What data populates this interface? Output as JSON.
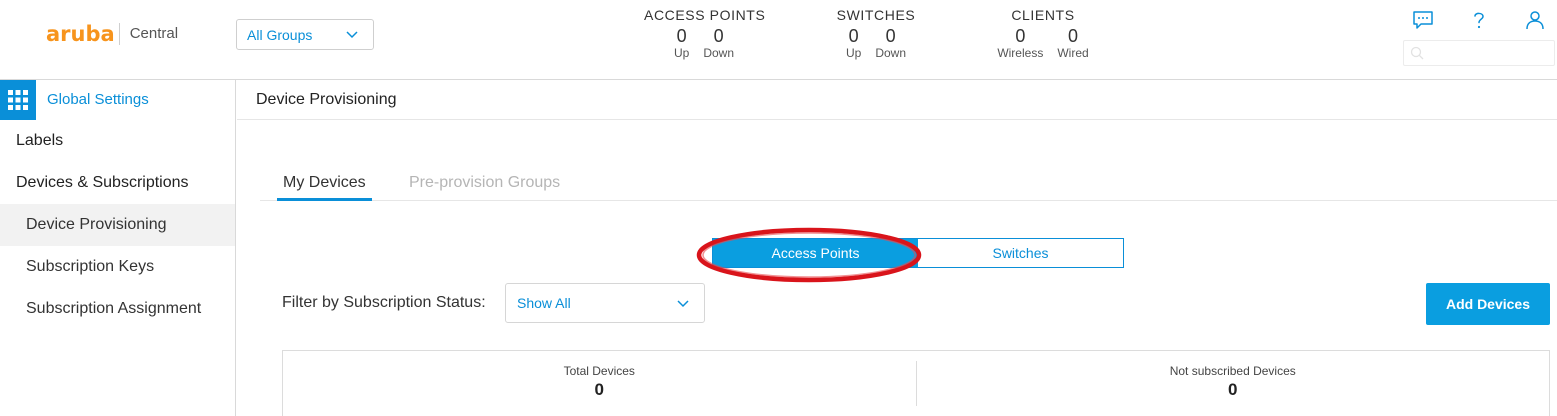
{
  "header": {
    "logo_word": "aruba",
    "logo_sub": "Central",
    "group_select": {
      "value": "All Groups"
    },
    "stats": {
      "access_points": {
        "title": "ACCESS POINTS",
        "cells": [
          {
            "value": "0",
            "label": "Up"
          },
          {
            "value": "0",
            "label": "Down"
          }
        ]
      },
      "switches": {
        "title": "SWITCHES",
        "cells": [
          {
            "value": "0",
            "label": "Up"
          },
          {
            "value": "0",
            "label": "Down"
          }
        ]
      },
      "clients": {
        "title": "CLIENTS",
        "cells": [
          {
            "value": "0",
            "label": "Wireless"
          },
          {
            "value": "0",
            "label": "Wired"
          }
        ]
      }
    },
    "icons": [
      "chat-icon",
      "help-icon",
      "user-icon",
      "search-icon"
    ],
    "search": {
      "placeholder": ""
    }
  },
  "sidebar": {
    "head_title": "Global Settings",
    "items": [
      {
        "label": "Labels",
        "level": "top",
        "active": false
      },
      {
        "label": "Devices & Subscriptions",
        "level": "top",
        "active": false
      },
      {
        "label": "Device Provisioning",
        "level": "sub",
        "active": true
      },
      {
        "label": "Subscription Keys",
        "level": "sub",
        "active": false
      },
      {
        "label": "Subscription Assignment",
        "level": "sub",
        "active": false
      }
    ]
  },
  "main": {
    "page_title": "Device Provisioning",
    "tabs": [
      {
        "label": "My Devices",
        "active": true
      },
      {
        "label": "Pre-provision Groups",
        "active": false
      }
    ],
    "segment": [
      {
        "label": "Access Points",
        "active": true
      },
      {
        "label": "Switches",
        "active": false
      }
    ],
    "filter": {
      "label": "Filter by Subscription Status:",
      "value": "Show All"
    },
    "add_button": "Add Devices",
    "summary": [
      {
        "label": "Total Devices",
        "value": "0"
      },
      {
        "label": "Not subscribed Devices",
        "value": "0"
      }
    ]
  },
  "colors": {
    "accent": "#0a8fd8",
    "brand_orange": "#f7941d",
    "highlight_red": "#d9141b"
  }
}
